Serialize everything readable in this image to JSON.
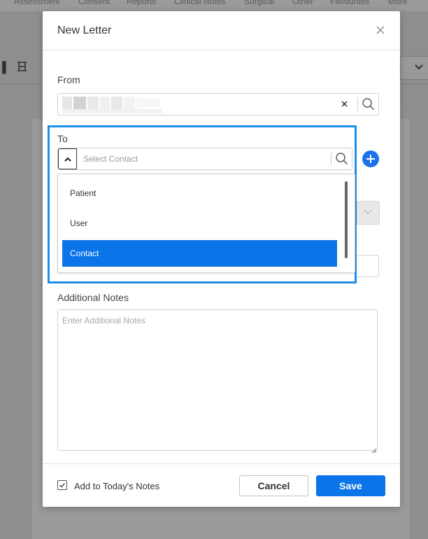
{
  "background": {
    "nav_items": [
      "Assessment",
      "Consent",
      "Reports",
      "Clinical Notes",
      "Surgical",
      "Other",
      "Favourites",
      "More"
    ]
  },
  "modal": {
    "title": "New Letter",
    "from": {
      "label": "From"
    },
    "to": {
      "label": "To",
      "placeholder": "Select Contact",
      "options": [
        "Patient",
        "User",
        "Contact"
      ],
      "selected_option": "Contact"
    },
    "additional_notes": {
      "label": "Additional Notes",
      "placeholder": "Enter Additional Notes"
    },
    "footer": {
      "checkbox_label": "Add to Today's Notes",
      "checkbox_checked": true,
      "cancel_label": "Cancel",
      "save_label": "Save"
    }
  },
  "colors": {
    "primary": "#0a74e8",
    "highlight_border": "#1f8fe6",
    "add_button": "#1a73e8"
  },
  "icons": {
    "close": "close-icon",
    "search": "search-icon",
    "clear": "clear-icon",
    "toggle": "chevron-up-icon",
    "add": "plus-circle-icon",
    "checkbox": "check-icon"
  }
}
